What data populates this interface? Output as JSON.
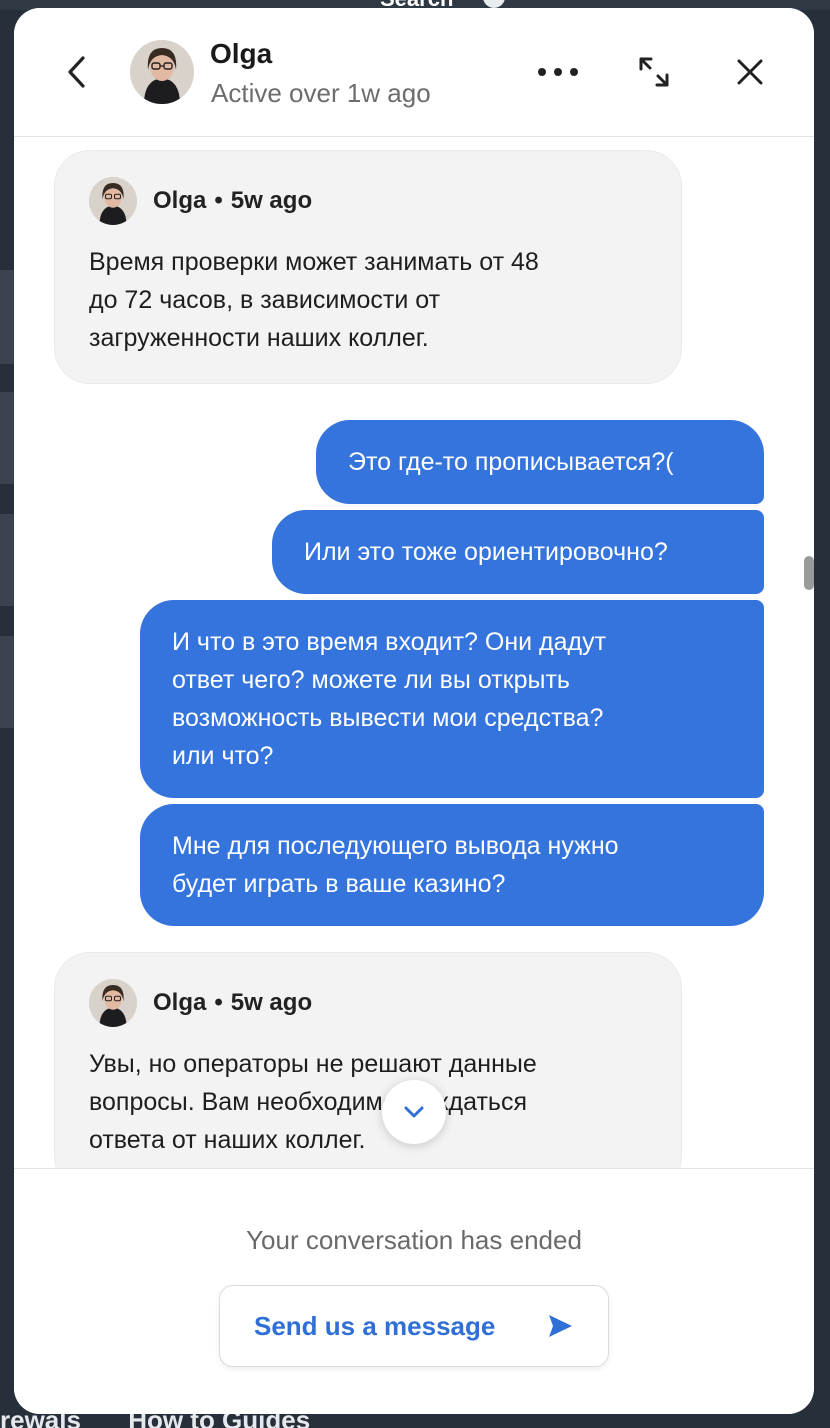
{
  "background": {
    "bottom_links": [
      "rewals",
      "How to Guides"
    ],
    "top_search_label": "Search"
  },
  "header": {
    "name": "Olga",
    "status": "Active over 1w ago",
    "icons": {
      "back": "chevron-left-icon",
      "more": "more-horizontal-icon",
      "expand": "expand-icon",
      "close": "close-icon"
    }
  },
  "messages": [
    {
      "type": "agent",
      "author": "Olga",
      "separator": "•",
      "time": "5w ago",
      "lines": [
        "Время проверки может занимать от 48",
        "до 72 часов, в зависимости от",
        "загруженности наших коллег."
      ]
    },
    {
      "type": "user",
      "lines": [
        "Это где-то прописывается?("
      ]
    },
    {
      "type": "user",
      "lines": [
        "Или это тоже ориентировочно?"
      ]
    },
    {
      "type": "user",
      "lines": [
        "И что в это время входит? Они дадут",
        "ответ чего? можете ли вы открыть",
        "возможность вывести мои средства?",
        "или что?"
      ]
    },
    {
      "type": "user",
      "lines": [
        "Мне для последующего вывода нужно",
        "будет играть в ваше казино?"
      ]
    },
    {
      "type": "agent",
      "author": "Olga",
      "separator": "•",
      "time": "5w ago",
      "lines": [
        "Увы, но операторы не решают данные",
        "вопросы. Вам необходимо дождаться",
        "ответа от наших коллег."
      ]
    }
  ],
  "footer": {
    "ended_text": "Your conversation has ended",
    "send_label": "Send us a message",
    "send_icon": "send-arrow-icon"
  },
  "colors": {
    "accent": "#3474dc",
    "link": "#2f6fd6",
    "agent_bubble": "#f3f3f3"
  }
}
